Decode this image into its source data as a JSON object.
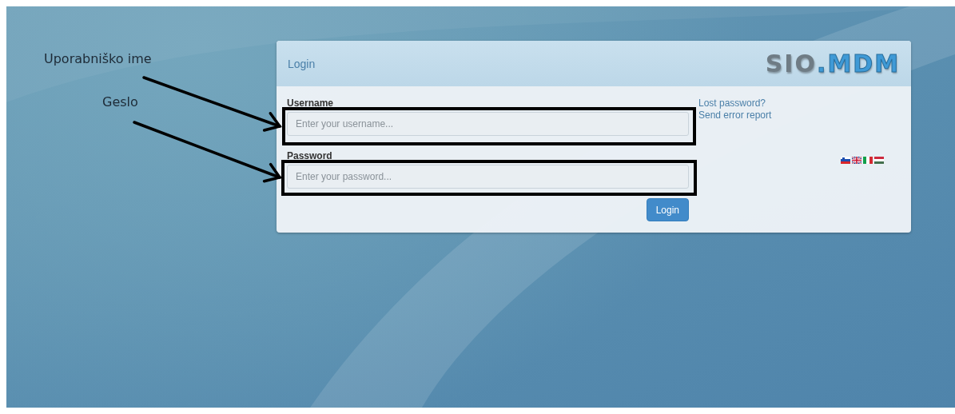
{
  "annotations": [
    {
      "label": "Uporabniško ime"
    },
    {
      "label": "Geslo"
    }
  ],
  "login": {
    "title": "Login",
    "logo": "SIO.MDM",
    "fields": [
      {
        "label": "Username",
        "placeholder": "Enter your username..."
      },
      {
        "label": "Password",
        "placeholder": "Enter your password..."
      }
    ],
    "button": "Login",
    "links": [
      "Lost password?",
      "Send error report"
    ],
    "languages": [
      {
        "kind": "si"
      },
      {
        "kind": "gb"
      },
      {
        "kind": "it"
      },
      {
        "kind": "hu"
      }
    ]
  }
}
